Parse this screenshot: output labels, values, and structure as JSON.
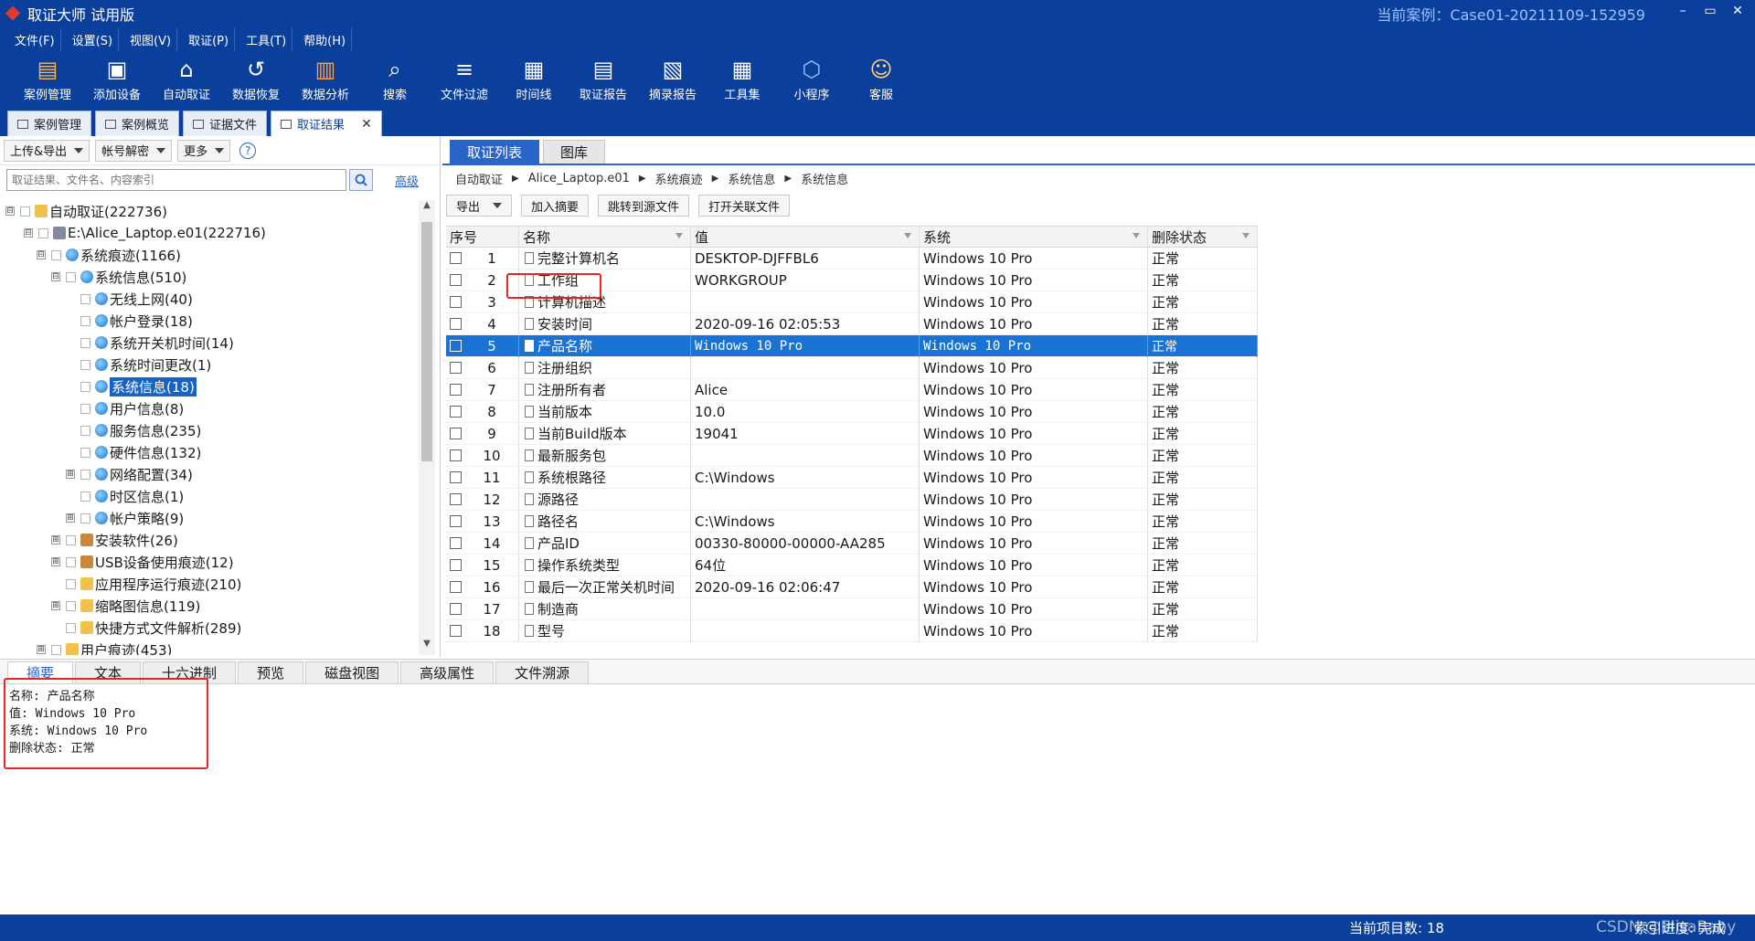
{
  "window": {
    "title": "取证大师 试用版",
    "case_label": "当前案例：Case01-20211109-152959",
    "controls": [
      "–",
      "▭",
      "✕"
    ]
  },
  "menu": [
    "文件(F)",
    "设置(S)",
    "视图(V)",
    "取证(P)",
    "工具(T)",
    "帮助(H)"
  ],
  "toolbar": [
    {
      "label": "案例管理",
      "icon": "case-manage-icon"
    },
    {
      "label": "添加设备",
      "icon": "add-device-icon"
    },
    {
      "label": "自动取证",
      "icon": "auto-forensics-icon"
    },
    {
      "label": "数据恢复",
      "icon": "data-recovery-icon"
    },
    {
      "label": "数据分析",
      "icon": "data-analysis-icon"
    },
    {
      "label": "搜索",
      "icon": "search-icon"
    },
    {
      "label": "文件过滤",
      "icon": "file-filter-icon"
    },
    {
      "label": "时间线",
      "icon": "timeline-icon"
    },
    {
      "label": "取证报告",
      "icon": "report-icon"
    },
    {
      "label": "摘录报告",
      "icon": "excerpt-report-icon"
    },
    {
      "label": "工具集",
      "icon": "toolset-icon"
    },
    {
      "label": "小程序",
      "icon": "miniprogram-icon"
    },
    {
      "label": "客服",
      "icon": "support-icon"
    }
  ],
  "doc_tabs": [
    "案例管理",
    "案例概览",
    "证据文件",
    "取证结果"
  ],
  "left": {
    "buttons": [
      "上传&导出",
      "帐号解密",
      "更多"
    ],
    "help": "?",
    "search_placeholder": "取证结果、文件名、内容索引",
    "advanced": "高级",
    "tree": [
      {
        "label": "自动取证(222736)",
        "expander": "⊟",
        "icon": "folder"
      },
      {
        "label": "E:\\Alice_Laptop.e01(222716)",
        "expander": "⊟",
        "icon": "drive"
      },
      {
        "label": "系统痕迹(1166)",
        "expander": "⊟",
        "icon": "globe"
      },
      {
        "label": "系统信息(510)",
        "expander": "⊟",
        "icon": "globe"
      },
      {
        "label": "无线上网(40)",
        "expander": "",
        "icon": "globe"
      },
      {
        "label": "帐户登录(18)",
        "expander": "",
        "icon": "globe"
      },
      {
        "label": "系统开关机时间(14)",
        "expander": "",
        "icon": "globe"
      },
      {
        "label": "系统时间更改(1)",
        "expander": "",
        "icon": "globe"
      },
      {
        "label": "系统信息(18)",
        "expander": "",
        "icon": "globe"
      },
      {
        "label": "用户信息(8)",
        "expander": "",
        "icon": "globe"
      },
      {
        "label": "服务信息(235)",
        "expander": "",
        "icon": "globe"
      },
      {
        "label": "硬件信息(132)",
        "expander": "",
        "icon": "globe"
      },
      {
        "label": "网络配置(34)",
        "expander": "⊞",
        "icon": "globe"
      },
      {
        "label": "时区信息(1)",
        "expander": "",
        "icon": "globe"
      },
      {
        "label": "帐户策略(9)",
        "expander": "⊞",
        "icon": "globe"
      },
      {
        "label": "安装软件(26)",
        "expander": "⊞",
        "icon": "app"
      },
      {
        "label": "USB设备使用痕迹(12)",
        "expander": "⊞",
        "icon": "app"
      },
      {
        "label": "应用程序运行痕迹(210)",
        "expander": "",
        "icon": "folder"
      },
      {
        "label": "缩略图信息(119)",
        "expander": "⊞",
        "icon": "folder"
      },
      {
        "label": "快捷方式文件解析(289)",
        "expander": "",
        "icon": "folder"
      },
      {
        "label": "用户痕迹(453)",
        "expander": "⊞",
        "icon": "folder"
      }
    ]
  },
  "right": {
    "tabs": [
      "取证列表",
      "图库"
    ],
    "breadcrumb": [
      "自动取证",
      "Alice_Laptop.e01",
      "系统痕迹",
      "系统信息",
      "系统信息"
    ],
    "buttons": {
      "export": "导出",
      "add_summary": "加入摘要",
      "jump_source": "跳转到源文件",
      "open_related": "打开关联文件"
    },
    "columns": [
      "序号",
      "名称",
      "值",
      "系统",
      "删除状态"
    ],
    "rows": [
      {
        "no": "1",
        "name": "完整计算机名",
        "value": "DESKTOP-DJFFBL6",
        "system": "Windows 10 Pro",
        "status": "正常"
      },
      {
        "no": "2",
        "name": "工作组",
        "value": "WORKGROUP",
        "system": "Windows 10 Pro",
        "status": "正常"
      },
      {
        "no": "3",
        "name": "计算机描述",
        "value": "",
        "system": "Windows 10 Pro",
        "status": "正常"
      },
      {
        "no": "4",
        "name": "安装时间",
        "value": "2020-09-16 02:05:53",
        "system": "Windows 10 Pro",
        "status": "正常"
      },
      {
        "no": "5",
        "name": "产品名称",
        "value": "Windows 10 Pro",
        "system": "Windows 10 Pro",
        "status": "正常"
      },
      {
        "no": "6",
        "name": "注册组织",
        "value": "",
        "system": "Windows 10 Pro",
        "status": "正常"
      },
      {
        "no": "7",
        "name": "注册所有者",
        "value": "Alice",
        "system": "Windows 10 Pro",
        "status": "正常"
      },
      {
        "no": "8",
        "name": "当前版本",
        "value": "10.0",
        "system": "Windows 10 Pro",
        "status": "正常"
      },
      {
        "no": "9",
        "name": "当前Build版本",
        "value": "19041",
        "system": "Windows 10 Pro",
        "status": "正常"
      },
      {
        "no": "10",
        "name": "最新服务包",
        "value": "",
        "system": "Windows 10 Pro",
        "status": "正常"
      },
      {
        "no": "11",
        "name": "系统根路径",
        "value": "C:\\Windows",
        "system": "Windows 10 Pro",
        "status": "正常"
      },
      {
        "no": "12",
        "name": "源路径",
        "value": "",
        "system": "Windows 10 Pro",
        "status": "正常"
      },
      {
        "no": "13",
        "name": "路径名",
        "value": "C:\\Windows",
        "system": "Windows 10 Pro",
        "status": "正常"
      },
      {
        "no": "14",
        "name": "产品ID",
        "value": "00330-80000-00000-AA285",
        "system": "Windows 10 Pro",
        "status": "正常"
      },
      {
        "no": "15",
        "name": "操作系统类型",
        "value": "64位",
        "system": "Windows 10 Pro",
        "status": "正常"
      },
      {
        "no": "16",
        "name": "最后一次正常关机时间",
        "value": "2020-09-16 02:06:47",
        "system": "Windows 10 Pro",
        "status": "正常"
      },
      {
        "no": "17",
        "name": "制造商",
        "value": "",
        "system": "Windows 10 Pro",
        "status": "正常"
      },
      {
        "no": "18",
        "name": "型号",
        "value": "",
        "system": "Windows 10 Pro",
        "status": "正常"
      }
    ]
  },
  "bottom": {
    "tabs": [
      "摘要",
      "文本",
      "十六进制",
      "预览",
      "磁盘视图",
      "高级属性",
      "文件溯源"
    ],
    "detail": [
      "名称: 产品名称",
      "值: Windows 10 Pro",
      "系统: Windows 10 Pro",
      "删除状态: 正常"
    ]
  },
  "status": {
    "count": "当前项目数: 18",
    "index": "索引进度: 完成",
    "watermark": "CSDN @ElisaBaby"
  },
  "colors": {
    "brand": "#0b3f9c",
    "selection": "#1a73d4",
    "highlight": "#e22525"
  }
}
